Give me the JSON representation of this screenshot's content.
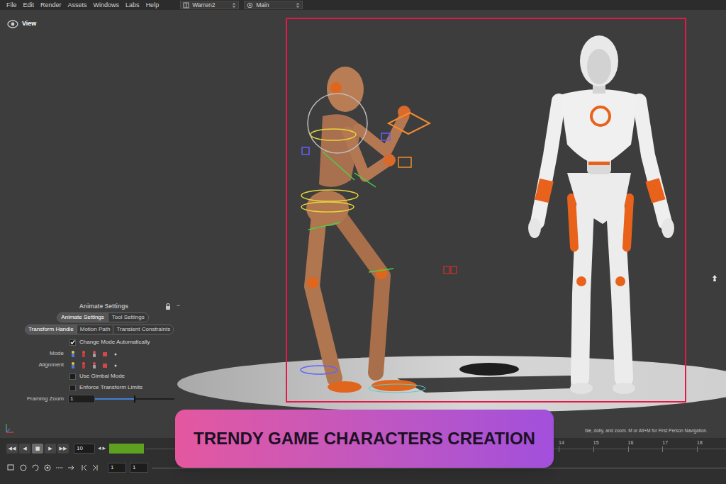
{
  "menu": [
    "File",
    "Edit",
    "Render",
    "Assets",
    "Windows",
    "Labs",
    "Help"
  ],
  "desktop": "Warren2",
  "context": "Main",
  "viewport": {
    "title": "View"
  },
  "panel": {
    "title": "Animate Settings",
    "collapse": "−",
    "tabs": [
      {
        "label": "Animate Settings",
        "selected": true
      },
      {
        "label": "Tool Settings",
        "selected": false
      }
    ],
    "subtabs": [
      {
        "label": "Transform Handle",
        "selected": true
      },
      {
        "label": "Motion Path",
        "selected": false
      },
      {
        "label": "Transient Constraints",
        "selected": false
      }
    ],
    "rows": [
      {
        "kind": "checkbox",
        "label": "Change Mode Automatically",
        "checked": true
      },
      {
        "kind": "icons",
        "label": "Mode"
      },
      {
        "kind": "icons",
        "label": "Alignment"
      },
      {
        "kind": "checkbox",
        "label": "Use Gimbal Mode",
        "checked": false
      },
      {
        "kind": "checkbox",
        "label": "Enforce Transform Limits",
        "checked": false
      },
      {
        "kind": "slider",
        "label": "Framing Zoom",
        "value": "1",
        "level": 0.5
      }
    ]
  },
  "status": "ble, dolly, and zoom. M or Alt+M for First Person Navigation.",
  "playback": {
    "buttons": [
      {
        "label": "◀◀",
        "selected": false
      },
      {
        "label": "◀",
        "selected": false
      },
      {
        "label": "■",
        "selected": true
      },
      {
        "label": "▶",
        "selected": false
      },
      {
        "label": "▶▶",
        "selected": false
      }
    ],
    "frame": "10",
    "step_back": "◂",
    "step_forward": "▸",
    "ticks": [
      "14",
      "15",
      "16",
      "17",
      "18"
    ],
    "range_start": "1",
    "range_end": "1"
  },
  "banner": {
    "title": "TRENDY GAME CHARACTERS CREATION"
  }
}
